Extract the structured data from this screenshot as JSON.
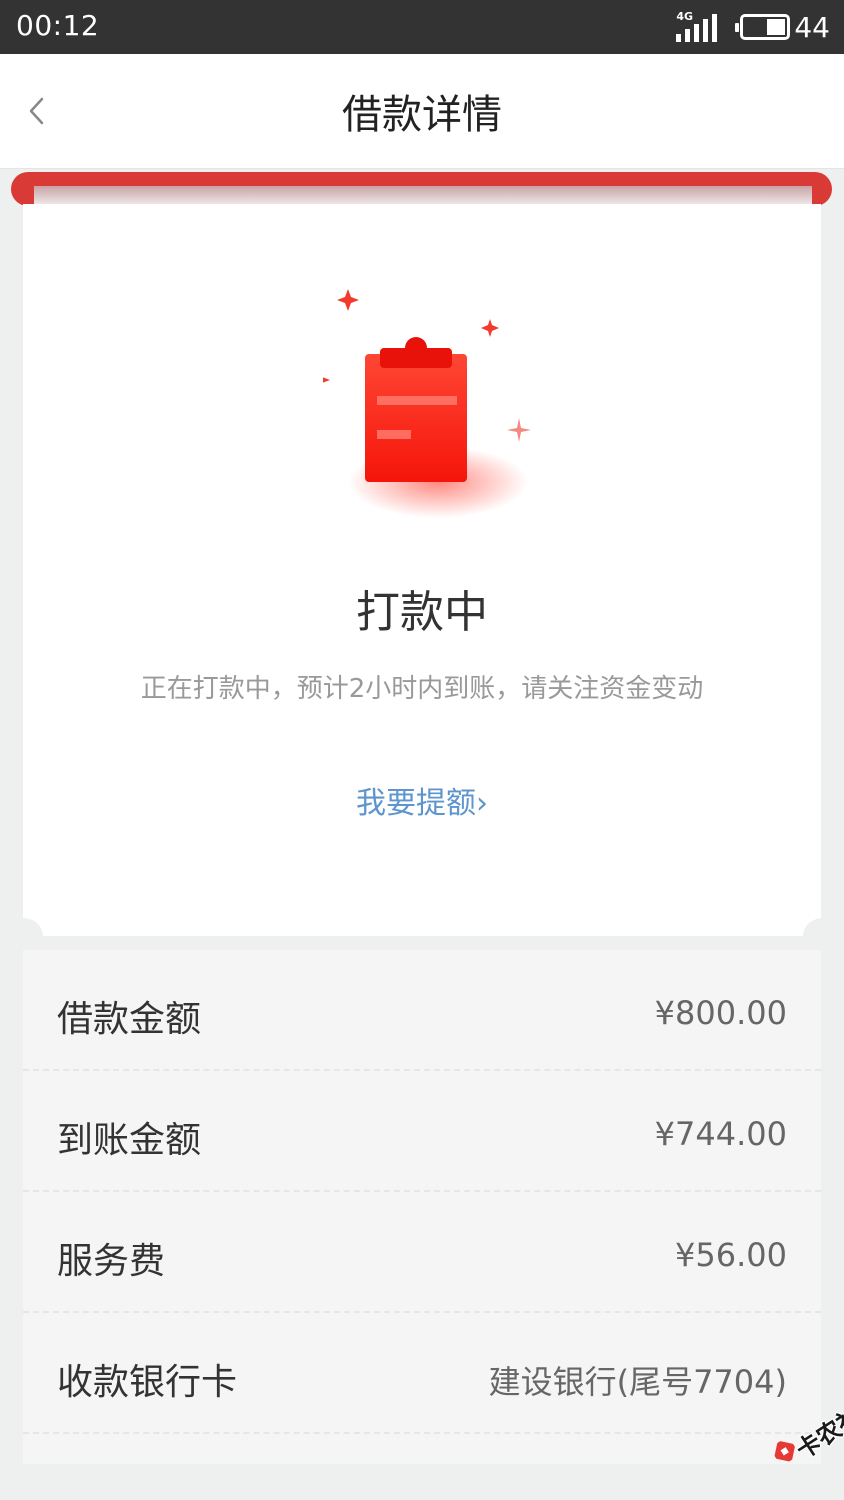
{
  "status_bar": {
    "time": "00:12",
    "network": "4G",
    "battery": "44",
    "battery_level": 0.44
  },
  "header": {
    "title": "借款详情"
  },
  "status": {
    "title": "打款中",
    "description": "正在打款中，预计2小时内到账，请关注资金变动",
    "link": "我要提额",
    "link_chevron": "›"
  },
  "details": [
    {
      "label": "借款金额",
      "value": "¥800.00"
    },
    {
      "label": "到账金额",
      "value": "¥744.00"
    },
    {
      "label": "服务费",
      "value": "¥56.00"
    },
    {
      "label": "收款银行卡",
      "value": "建设银行(尾号7704)"
    }
  ],
  "watermark": {
    "text": "卡农社区"
  },
  "colors": {
    "accent_red": "#e53935",
    "link_blue": "#5d95cc",
    "status_bar": "#333333"
  }
}
